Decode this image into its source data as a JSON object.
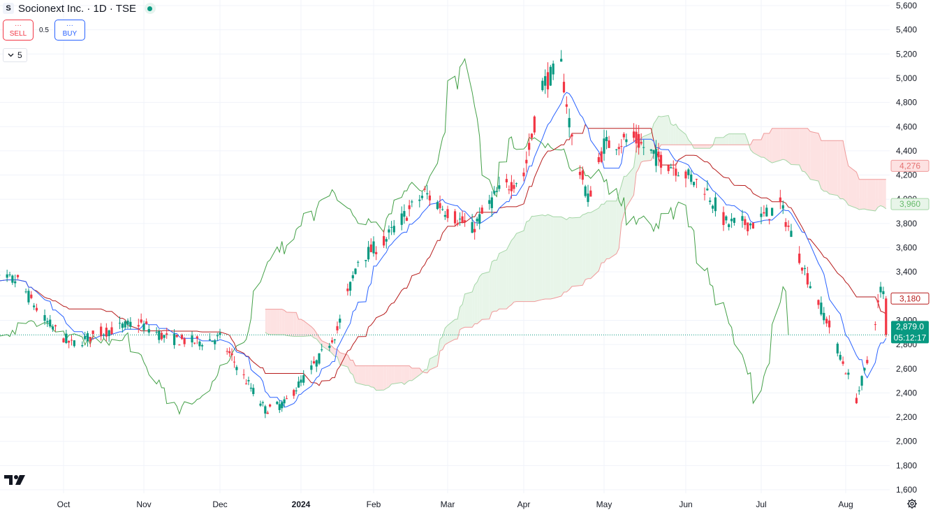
{
  "header": {
    "symbol_badge": "S",
    "title": "Socionext Inc. · 1D · TSE"
  },
  "trade": {
    "sell_dots": "···",
    "sell_label": "SELL",
    "spread": "0.5",
    "buy_dots": "···",
    "buy_label": "BUY"
  },
  "indicators_toggle": {
    "count": "5"
  },
  "colors": {
    "up": "#089981",
    "down": "#f23645",
    "tenkan": "#2962ff",
    "kijun": "#b71c1c",
    "chikou": "#43a047",
    "span_a": "#a5d6a7",
    "span_b": "#ef9a9a",
    "cloud_bull": "#e8f5e9",
    "cloud_bear": "#fde2e2"
  },
  "icons": [
    "chevron-down-icon",
    "tradingview-logo-icon",
    "gear-icon"
  ],
  "chart_data": {
    "type": "candlestick",
    "indicator": "Ichimoku Cloud",
    "y_axis_ticks": [
      5600,
      5400,
      5200,
      5000,
      4800,
      4600,
      4400,
      4200,
      4000,
      3800,
      3600,
      3400,
      3200,
      3000,
      2800,
      2600,
      2400,
      2200,
      2000,
      1800,
      1600
    ],
    "y_tick_labels": [
      "5,600",
      "5,400",
      "5,200",
      "5,000",
      "4,800",
      "4,600",
      "4,400",
      "4,200",
      "4,000",
      "3,800",
      "3,600",
      "3,400",
      "3,200",
      "3,000",
      "2,800",
      "2,600",
      "2,400",
      "2,200",
      "2,000",
      "1,800",
      "1,600"
    ],
    "ylim": [
      1560,
      5620
    ],
    "x_tick_labels": [
      "Oct",
      "Nov",
      "Dec",
      "2024",
      "Feb",
      "Mar",
      "Apr",
      "May",
      "Jun",
      "Jul",
      "Aug"
    ],
    "x_tick_dates": [
      "2023-10-02",
      "2023-11-01",
      "2023-12-01",
      "2024-01-04",
      "2024-02-01",
      "2024-03-01",
      "2024-04-01",
      "2024-05-01",
      "2024-06-03",
      "2024-07-01",
      "2024-08-01"
    ],
    "last_price": 2879.0,
    "last_price_label": "2,879.0",
    "countdown": "05:12:17",
    "price_labels": [
      {
        "value": 4276,
        "label": "4,276",
        "series": "span_b"
      },
      {
        "value": 3960,
        "label": "3,960",
        "series": "span_a"
      },
      {
        "value": 3180,
        "label": "3,180",
        "series": "kijun"
      }
    ],
    "close_anchors": [
      [
        "2023-09-15",
        3330
      ],
      [
        "2023-09-25",
        3000
      ],
      [
        "2023-10-05",
        2800
      ],
      [
        "2023-10-16",
        2900
      ],
      [
        "2023-10-30",
        2980
      ],
      [
        "2023-11-10",
        2850
      ],
      [
        "2023-11-22",
        2820
      ],
      [
        "2023-12-01",
        2850
      ],
      [
        "2023-12-12",
        2500
      ],
      [
        "2023-12-20",
        2260
      ],
      [
        "2023-12-28",
        2310
      ],
      [
        "2024-01-10",
        2650
      ],
      [
        "2024-01-18",
        2920
      ],
      [
        "2024-01-26",
        3500
      ],
      [
        "2024-02-05",
        3650
      ],
      [
        "2024-02-13",
        3860
      ],
      [
        "2024-02-21",
        4050
      ],
      [
        "2024-03-01",
        3900
      ],
      [
        "2024-03-11",
        3750
      ],
      [
        "2024-03-21",
        4050
      ],
      [
        "2024-04-01",
        4200
      ],
      [
        "2024-04-08",
        4950
      ],
      [
        "2024-04-15",
        5100
      ],
      [
        "2024-04-19",
        4500
      ],
      [
        "2024-04-25",
        4000
      ],
      [
        "2024-05-01",
        4450
      ],
      [
        "2024-05-13",
        4500
      ],
      [
        "2024-05-22",
        4350
      ],
      [
        "2024-05-31",
        4250
      ],
      [
        "2024-06-10",
        4100
      ],
      [
        "2024-06-18",
        3800
      ],
      [
        "2024-06-28",
        3800
      ],
      [
        "2024-07-08",
        3950
      ],
      [
        "2024-07-18",
        3350
      ],
      [
        "2024-07-26",
        2950
      ],
      [
        "2024-08-05",
        2350
      ],
      [
        "2024-08-09",
        2650
      ],
      [
        "2024-08-14",
        3250
      ],
      [
        "2024-08-16",
        3180
      ]
    ],
    "series_shown": [
      "price",
      "tenkan",
      "kijun",
      "chikou",
      "span_a",
      "span_b"
    ]
  }
}
